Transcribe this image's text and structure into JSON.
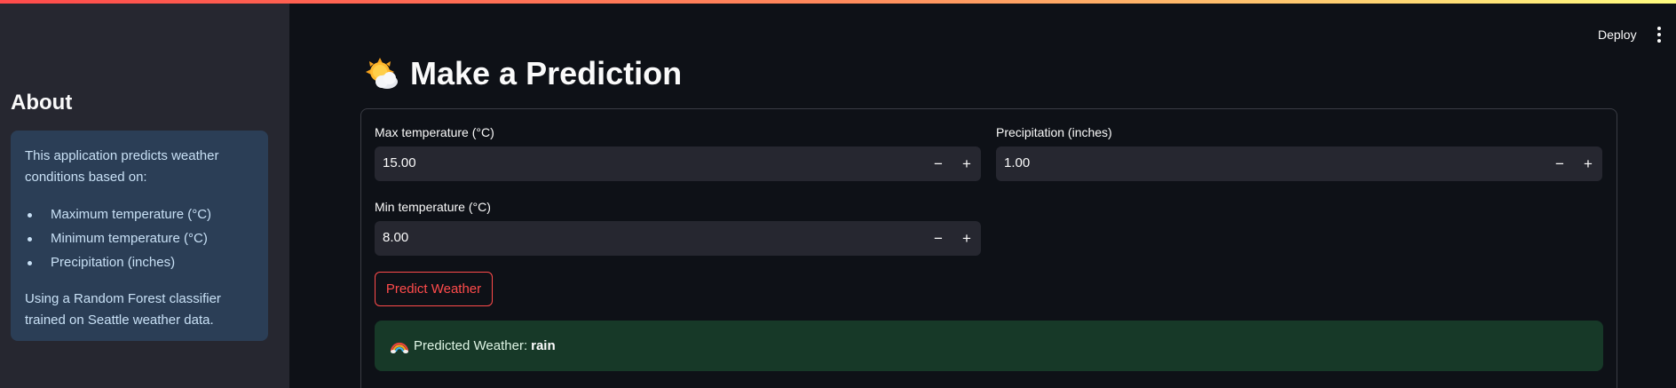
{
  "header": {
    "deploy_label": "Deploy"
  },
  "sidebar": {
    "title": "About",
    "intro": "This application predicts weather conditions based on:",
    "items": [
      "Maximum temperature (°C)",
      "Minimum temperature (°C)",
      "Precipitation (inches)"
    ],
    "footer": "Using a Random Forest classifier trained on Seattle weather data."
  },
  "main": {
    "title": "Make a Prediction",
    "title_icon": "sun-behind-cloud-icon",
    "fields": {
      "max_temp": {
        "label": "Max temperature (°C)",
        "value": "15.00"
      },
      "precip": {
        "label": "Precipitation (inches)",
        "value": "1.00"
      },
      "min_temp": {
        "label": "Min temperature (°C)",
        "value": "8.00"
      }
    },
    "stepper": {
      "minus": "−",
      "plus": "+"
    },
    "predict_button": "Predict Weather",
    "result": {
      "icon": "rainbow-icon",
      "label": "Predicted Weather:",
      "value": "rain"
    }
  },
  "colors": {
    "accent": "#ff4b4b",
    "background": "#0e1117",
    "sidebar": "#262730",
    "info_box": "#2b3e56",
    "success_box": "#173928"
  }
}
